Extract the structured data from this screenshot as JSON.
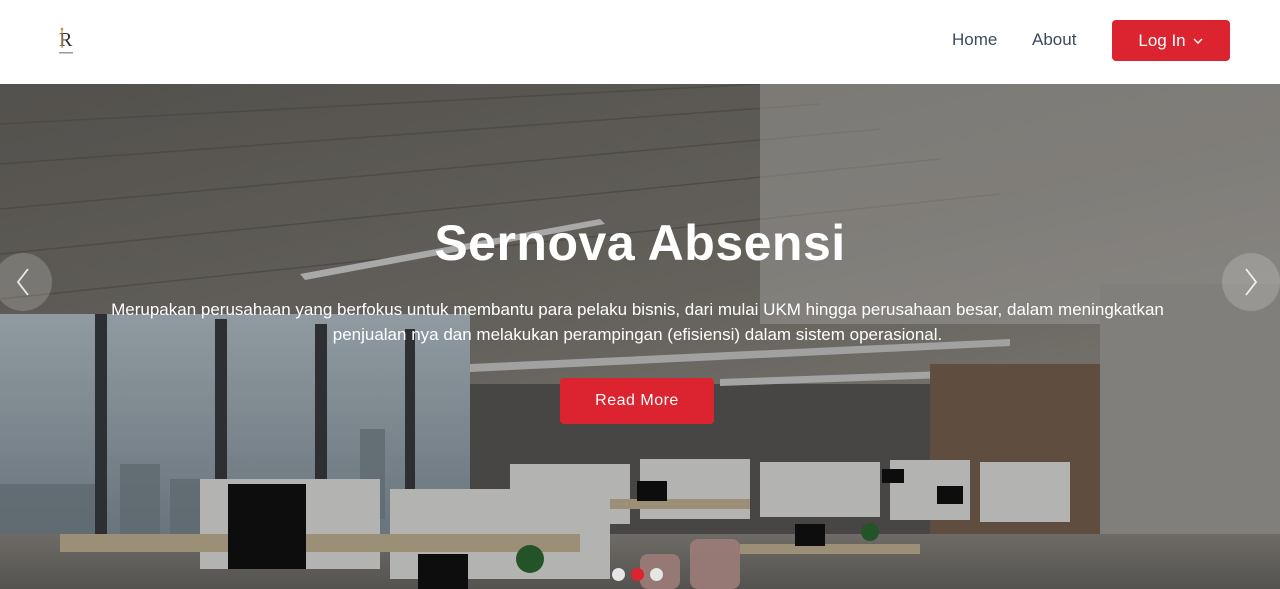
{
  "header": {
    "logo_icon": "sernova-logo-icon",
    "nav": {
      "home": "Home",
      "about": "About"
    },
    "login_label": "Log In",
    "login_icon": "chevron-down-icon"
  },
  "hero": {
    "title": "Sernova Absensi",
    "description": "Merupakan perusahaan yang berfokus untuk membantu para pelaku bisnis, dari mulai UKM hingga perusahaan besar, dalam meningkatkan penjualan nya dan melakukan perampingan (efisiensi) dalam sistem operasional.",
    "cta_label": "Read More",
    "prev_icon": "chevron-left-icon",
    "next_icon": "chevron-right-icon",
    "slides": {
      "count": 3,
      "active": 2
    }
  },
  "colors": {
    "accent": "#dc2330",
    "nav_text": "#3e4a5c",
    "white": "#ffffff"
  }
}
